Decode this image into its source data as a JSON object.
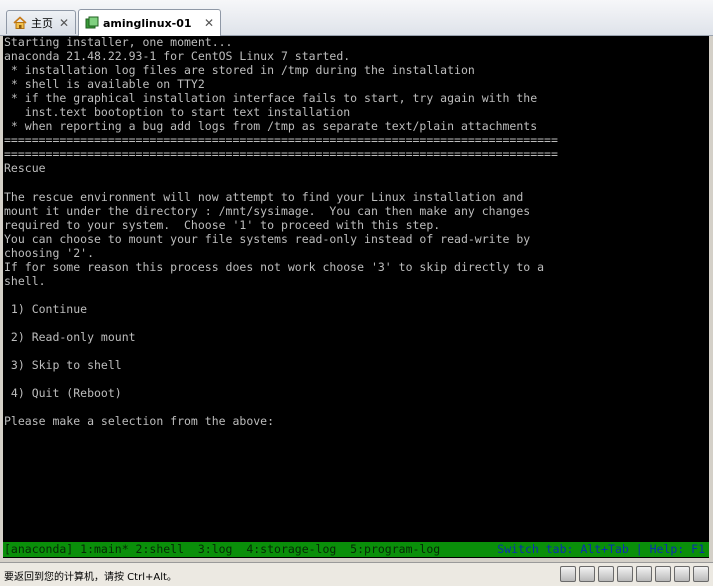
{
  "tabs": [
    {
      "label": "主页",
      "icon": "home-icon",
      "active": false
    },
    {
      "label": "aminglinux-01",
      "icon": "vm-icon",
      "active": true
    }
  ],
  "terminal": {
    "lines": [
      "Starting installer, one moment...",
      "anaconda 21.48.22.93-1 for CentOS Linux 7 started.",
      " * installation log files are stored in /tmp during the installation",
      " * shell is available on TTY2",
      " * if the graphical installation interface fails to start, try again with the",
      "   inst.text bootoption to start text installation",
      " * when reporting a bug add logs from /tmp as separate text/plain attachments",
      "================================================================================",
      "================================================================================",
      "Rescue",
      "",
      "The rescue environment will now attempt to find your Linux installation and",
      "mount it under the directory : /mnt/sysimage.  You can then make any changes",
      "required to your system.  Choose '1' to proceed with this step.",
      "You can choose to mount your file systems read-only instead of read-write by",
      "choosing '2'.",
      "If for some reason this process does not work choose '3' to skip directly to a",
      "shell.",
      "",
      " 1) Continue",
      "",
      " 2) Read-only mount",
      "",
      " 3) Skip to shell",
      "",
      " 4) Quit (Reboot)",
      "",
      "Please make a selection from the above:"
    ],
    "status_left": "[anaconda] 1:main* 2:shell  3:log  4:storage-log  5:program-log",
    "status_right": "Switch tab: Alt+Tab | Help: F1"
  },
  "statusbar": {
    "hint": "要返回到您的计算机，请按 Ctrl+Alt。",
    "tray_icons": [
      "hard-disk-icon",
      "cd-drive-icon",
      "network-adapter-icon",
      "printer-icon",
      "sound-card-icon",
      "usb-icon",
      "display-icon",
      "message-icon"
    ]
  },
  "colors": {
    "terminal_bg": "#000000",
    "terminal_fg": "#bdbdbd",
    "status_bar_green": "#0a8f0a"
  }
}
